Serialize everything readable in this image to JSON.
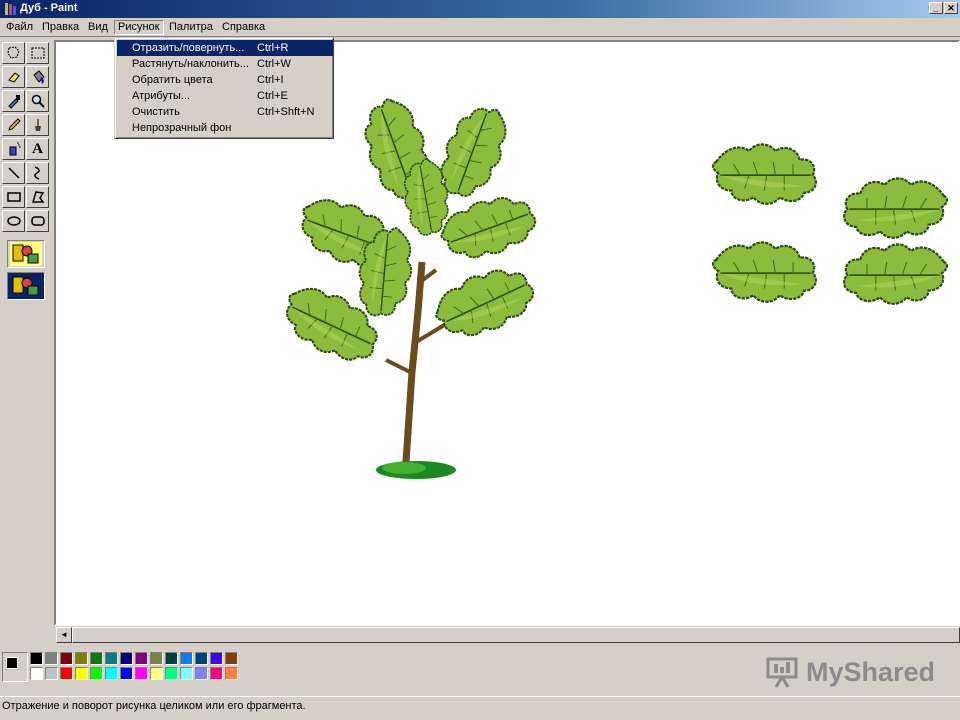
{
  "titlebar": {
    "title": "Дуб - Paint",
    "minimize_glyph": "_",
    "close_glyph": "✕"
  },
  "menubar": {
    "items": [
      {
        "label": "Файл"
      },
      {
        "label": "Правка"
      },
      {
        "label": "Вид"
      },
      {
        "label": "Рисунок"
      },
      {
        "label": "Палитра"
      },
      {
        "label": "Справка"
      }
    ]
  },
  "image_menu": {
    "items": [
      {
        "label": "Отразить/повернуть...",
        "shortcut": "Ctrl+R",
        "highlighted": true
      },
      {
        "label": "Растянуть/наклонить...",
        "shortcut": "Ctrl+W"
      },
      {
        "label": "Обратить цвета",
        "shortcut": "Ctrl+I"
      },
      {
        "label": "Атрибуты...",
        "shortcut": "Ctrl+E"
      },
      {
        "label": "Очистить",
        "shortcut": "Ctrl+Shft+N"
      },
      {
        "label": "Непрозрачный фон",
        "shortcut": ""
      }
    ]
  },
  "toolbox": {
    "tools": [
      {
        "name": "free-select-icon"
      },
      {
        "name": "rect-select-icon"
      },
      {
        "name": "eraser-icon"
      },
      {
        "name": "fill-icon"
      },
      {
        "name": "color-picker-icon"
      },
      {
        "name": "magnifier-icon"
      },
      {
        "name": "pencil-icon"
      },
      {
        "name": "brush-icon"
      },
      {
        "name": "airbrush-icon"
      },
      {
        "name": "text-icon",
        "glyph": "A"
      },
      {
        "name": "line-icon"
      },
      {
        "name": "curve-icon"
      },
      {
        "name": "rectangle-icon"
      },
      {
        "name": "polygon-icon"
      },
      {
        "name": "ellipse-icon"
      },
      {
        "name": "rounded-rect-icon"
      }
    ]
  },
  "colors": {
    "foreground": "#000000",
    "background": "#ffffff",
    "palette_top": [
      "#000000",
      "#808080",
      "#800000",
      "#808000",
      "#008000",
      "#008080",
      "#000080",
      "#800080",
      "#808040",
      "#004040",
      "#0080ff",
      "#004080",
      "#4000ff",
      "#804000"
    ],
    "palette_bottom": [
      "#ffffff",
      "#c0c0c0",
      "#ff0000",
      "#ffff00",
      "#00ff00",
      "#00ffff",
      "#0000ff",
      "#ff00ff",
      "#ffff80",
      "#00ff80",
      "#80ffff",
      "#8080ff",
      "#ff0080",
      "#ff8040"
    ]
  },
  "status": {
    "text": "Отражение и поворот рисунка целиком или его фрагмента."
  },
  "watermark": {
    "text": "MyShared"
  }
}
